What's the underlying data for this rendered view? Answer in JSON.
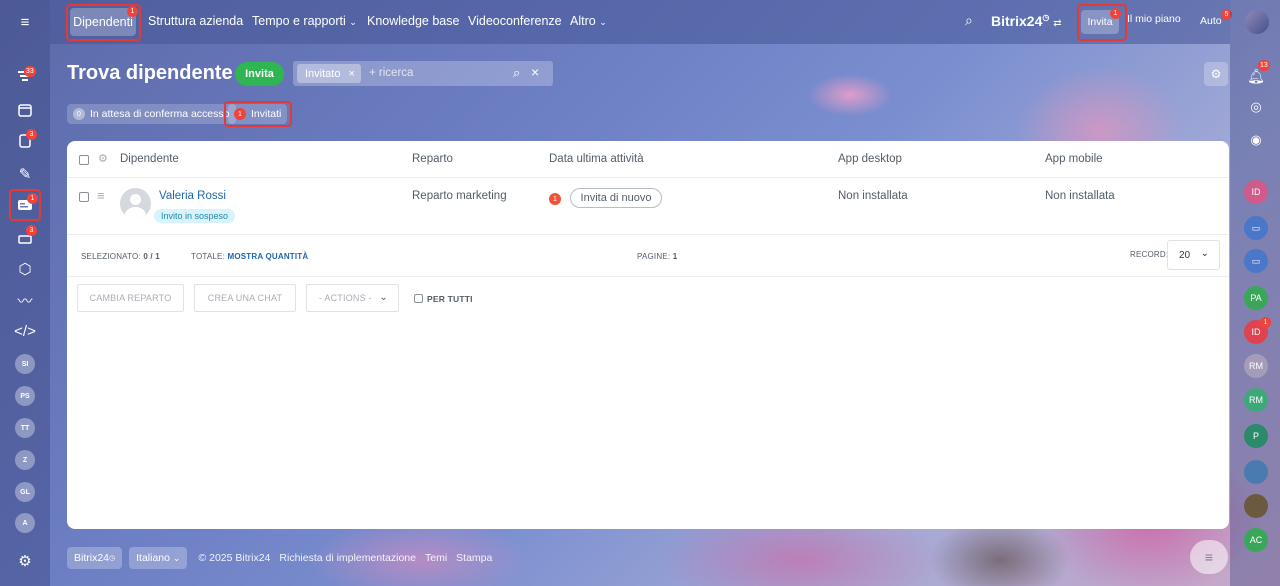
{
  "topbar": {
    "active_tab": "Dipendenti",
    "active_badge": "1",
    "tabs": [
      "Struttura azienda",
      "Tempo e rapporti",
      "Knowledge base",
      "Videoconferenze",
      "Altro"
    ],
    "brand": "Bitrix",
    "brand_num": "24",
    "invite_label": "Invita",
    "invite_badge": "1",
    "plan_label": "Il mio piano",
    "auto_label": "Auto",
    "auto_badge": "5"
  },
  "sidebar": {
    "badges": [
      "33",
      "3",
      "1",
      "3"
    ],
    "avatars": [
      "SI",
      "PS",
      "TT",
      "Z",
      "GL",
      "A"
    ]
  },
  "header": {
    "title": "Trova dipendente",
    "invite_button": "Invita",
    "filter_chip": "Invitato",
    "search_placeholder": "+ ricerca",
    "pending_count": "0",
    "pending_label": "In attesa di conferma accesso",
    "invited_count": "1",
    "invited_label": "Invitati"
  },
  "table": {
    "columns": [
      "Dipendente",
      "Reparto",
      "Data ultima attività",
      "App desktop",
      "App mobile"
    ],
    "rows": [
      {
        "name": "Valeria Rossi",
        "status": "Invito in sospeso",
        "department": "Reparto marketing",
        "activity_badge": "1",
        "resend_button": "Invita di nuovo",
        "desktop": "Non installata",
        "mobile": "Non installata"
      }
    ]
  },
  "footer_bar": {
    "selected_label": "SELEZIONATO:",
    "selected_value": "0 / 1",
    "total_label": "TOTALE:",
    "total_link": "MOSTRA QUANTITÀ",
    "pages_label": "PAGINE:",
    "pages_value": "1",
    "records_label": "RECORD:",
    "records_value": "20"
  },
  "actions": {
    "change_dept": "CAMBIA REPARTO",
    "create_chat": "CREA UNA CHAT",
    "actions_select": "- ACTIONS -",
    "for_all": "PER TUTTI"
  },
  "page_footer": {
    "brand": "Bitrix24",
    "language": "Italiano",
    "copyright": "© 2025 Bitrix24",
    "links": [
      "Richiesta di implementazione",
      "Temi",
      "Stampa"
    ]
  },
  "rightrail": {
    "bell_badge": "13",
    "avatars": [
      "ID",
      "PA",
      "ID",
      "RM",
      "RM",
      "P",
      "AC"
    ],
    "id_badge": "1"
  }
}
